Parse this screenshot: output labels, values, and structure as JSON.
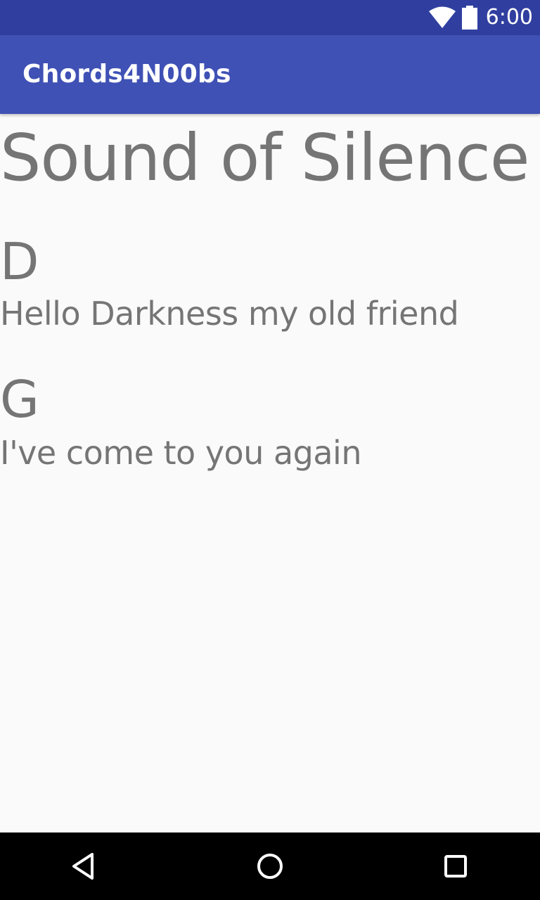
{
  "status_bar": {
    "time": "6:00",
    "icons": [
      "wifi-icon",
      "battery-icon"
    ]
  },
  "app_bar": {
    "title": "Chords4N00bs",
    "color": "#3f51b5",
    "status_color": "#303f9f"
  },
  "song": {
    "title": "Sound of Silence",
    "lines": [
      {
        "chord": "D",
        "lyric": "Hello Darkness my old friend"
      },
      {
        "chord": "G",
        "lyric": "I've come to you again"
      }
    ]
  },
  "nav_bar": {
    "buttons": [
      "back-icon",
      "home-icon",
      "recents-icon"
    ]
  },
  "colors": {
    "text": "#757575",
    "background": "#fafafa"
  }
}
